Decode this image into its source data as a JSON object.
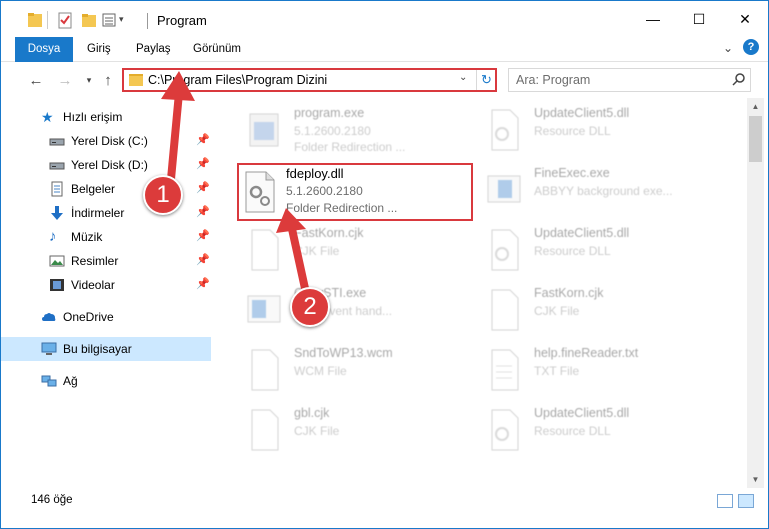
{
  "window": {
    "title": "Program",
    "controls": {
      "minimize": "—",
      "maximize": "☐",
      "close": "✕"
    }
  },
  "ribbon": {
    "tabs": [
      "Dosya",
      "Giriş",
      "Paylaş",
      "Görünüm"
    ],
    "expand": "⌄",
    "help": "?"
  },
  "address": {
    "path": "C:\\Program Files\\Program Dizini",
    "dropdown": "⌄",
    "refresh": "↻"
  },
  "search": {
    "placeholder": "Ara: Program"
  },
  "sidebar": {
    "items": [
      {
        "label": "Hızlı erişim",
        "icon": "star-icon"
      },
      {
        "label": "Yerel Disk (C:)",
        "icon": "drive-icon",
        "pinned": "📌"
      },
      {
        "label": "Yerel Disk (D:)",
        "icon": "drive-icon",
        "pinned": "📌"
      },
      {
        "label": "Belgeler",
        "icon": "documents-icon",
        "pinned": "📌"
      },
      {
        "label": "İndirmeler",
        "icon": "download-icon",
        "pinned": "📌"
      },
      {
        "label": "Müzik",
        "icon": "music-icon",
        "pinned": "📌"
      },
      {
        "label": "Resimler",
        "icon": "pictures-icon",
        "pinned": "📌"
      },
      {
        "label": "Videolar",
        "icon": "videos-icon",
        "pinned": "📌"
      },
      {
        "label": "OneDrive",
        "icon": "cloud-icon"
      },
      {
        "label": "Bu bilgisayar",
        "icon": "computer-icon"
      },
      {
        "label": "Ağ",
        "icon": "network-icon"
      }
    ]
  },
  "files": {
    "focused": {
      "name": "fdeploy.dll",
      "version": "5.1.2600.2180",
      "desc": "Folder Redirection ..."
    },
    "left": [
      {
        "name": "program.exe",
        "l2": "5.1.2600.2180",
        "l3": "Folder Redirection ..."
      },
      {
        "name": "FastKorn.cjk",
        "l2": "CJK File"
      },
      {
        "name": "CopySTI.exe",
        "l2": "Multi event hand..."
      },
      {
        "name": "SndToWP13.wcm",
        "l2": "WCM File"
      },
      {
        "name": "gbl.cjk",
        "l2": "CJK File"
      }
    ],
    "right": [
      {
        "name": "UpdateClient5.dll",
        "l2": "Resource DLL"
      },
      {
        "name": "FineExec.exe",
        "l2": "ABBYY background exe..."
      },
      {
        "name": "UpdateClient5.dll",
        "l2": "Resource DLL"
      },
      {
        "name": "FastKorn.cjk",
        "l2": "CJK File"
      },
      {
        "name": "help.fineReader.txt",
        "l2": "TXT File"
      },
      {
        "name": "UpdateClient5.dll",
        "l2": "Resource DLL"
      }
    ]
  },
  "annotations": {
    "badge1": "1",
    "badge2": "2"
  },
  "status": {
    "count": "146 öğe"
  }
}
